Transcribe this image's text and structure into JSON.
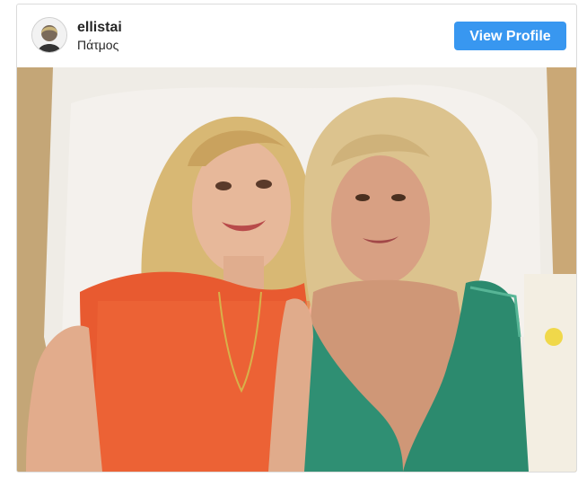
{
  "post": {
    "username": "ellistai",
    "location": "Πάτμος",
    "view_profile_label": "View Profile",
    "accent_color": "#3897f0"
  },
  "photo": {
    "icon": "photo-of-two-women"
  }
}
